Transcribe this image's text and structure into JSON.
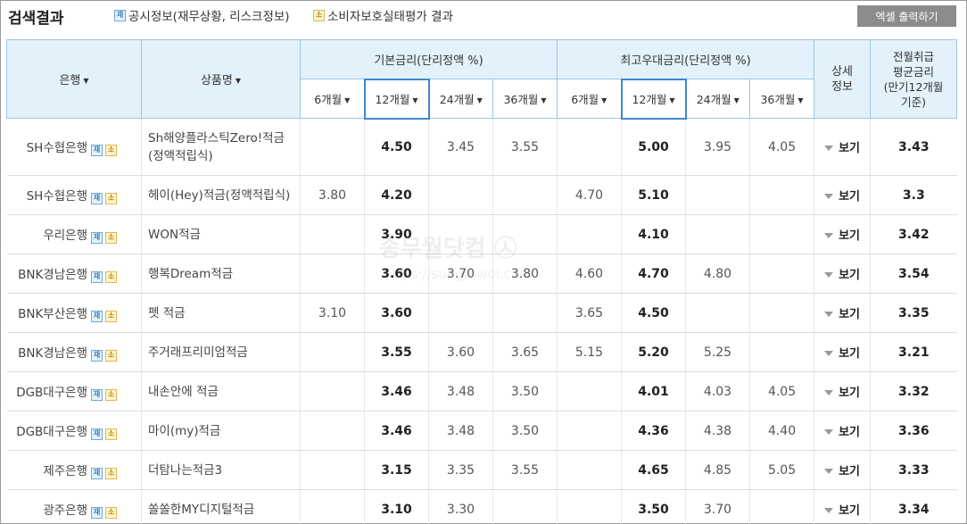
{
  "header": {
    "title": "검색결과",
    "legend_disclosure_badge": "재",
    "legend_disclosure_label": "공시정보(재무상황, 리스크정보)",
    "legend_consumer_badge": "소",
    "legend_consumer_label": "소비자보호실태평가 결과",
    "excel_button": "엑셀 출력하기"
  },
  "columns": {
    "bank": "은행",
    "product": "상품명",
    "base_rate": "기본금리(단리정액 %)",
    "max_rate": "최고우대금리(단리정액 %)",
    "detail": "상세\n정보",
    "avg_rate": "전월취급\n평균금리\n(만기12개월\n기준)",
    "terms": [
      "6개월",
      "12개월",
      "24개월",
      "36개월"
    ]
  },
  "detail_label": "보기",
  "watermark": {
    "line1": "송무월닷컴 ㉦",
    "line2": "https://songmwol.com"
  },
  "rows": [
    {
      "bank": "SH수협은행",
      "product": "Sh해양플라스틱Zero!적금\n(정액적립식)",
      "base": [
        "",
        "4.50",
        "3.45",
        "3.55"
      ],
      "max": [
        "",
        "5.00",
        "3.95",
        "4.05"
      ],
      "avg": "3.43"
    },
    {
      "bank": "SH수협은행",
      "product": "헤이(Hey)적금(정액적립식)",
      "base": [
        "3.80",
        "4.20",
        "",
        ""
      ],
      "max": [
        "4.70",
        "5.10",
        "",
        ""
      ],
      "avg": "3.3"
    },
    {
      "bank": "우리은행",
      "product": "WON적금",
      "base": [
        "",
        "3.90",
        "",
        ""
      ],
      "max": [
        "",
        "4.10",
        "",
        ""
      ],
      "avg": "3.42"
    },
    {
      "bank": "BNK경남은행",
      "product": "행복Dream적금",
      "base": [
        "",
        "3.60",
        "3.70",
        "3.80"
      ],
      "max": [
        "4.60",
        "4.70",
        "4.80",
        ""
      ],
      "avg": "3.54"
    },
    {
      "bank": "BNK부산은행",
      "product": "펫 적금",
      "base": [
        "3.10",
        "3.60",
        "",
        ""
      ],
      "max": [
        "3.65",
        "4.50",
        "",
        ""
      ],
      "avg": "3.35"
    },
    {
      "bank": "BNK경남은행",
      "product": "주거래프리미엄적금",
      "base": [
        "",
        "3.55",
        "3.60",
        "3.65"
      ],
      "max": [
        "5.15",
        "5.20",
        "5.25",
        ""
      ],
      "avg": "3.21"
    },
    {
      "bank": "DGB대구은행",
      "product": "내손안에 적금",
      "base": [
        "",
        "3.46",
        "3.48",
        "3.50"
      ],
      "max": [
        "",
        "4.01",
        "4.03",
        "4.05"
      ],
      "avg": "3.32"
    },
    {
      "bank": "DGB대구은행",
      "product": "마이(my)적금",
      "base": [
        "",
        "3.46",
        "3.48",
        "3.50"
      ],
      "max": [
        "",
        "4.36",
        "4.38",
        "4.40"
      ],
      "avg": "3.36"
    },
    {
      "bank": "제주은행",
      "product": "더탐나는적금3",
      "base": [
        "",
        "3.15",
        "3.35",
        "3.55"
      ],
      "max": [
        "",
        "4.65",
        "4.85",
        "5.05"
      ],
      "avg": "3.33"
    },
    {
      "bank": "광주은행",
      "product": "쏠쏠한MY디지털적금",
      "base": [
        "",
        "3.10",
        "3.30",
        ""
      ],
      "max": [
        "",
        "3.50",
        "3.70",
        ""
      ],
      "avg": "3.34"
    }
  ]
}
